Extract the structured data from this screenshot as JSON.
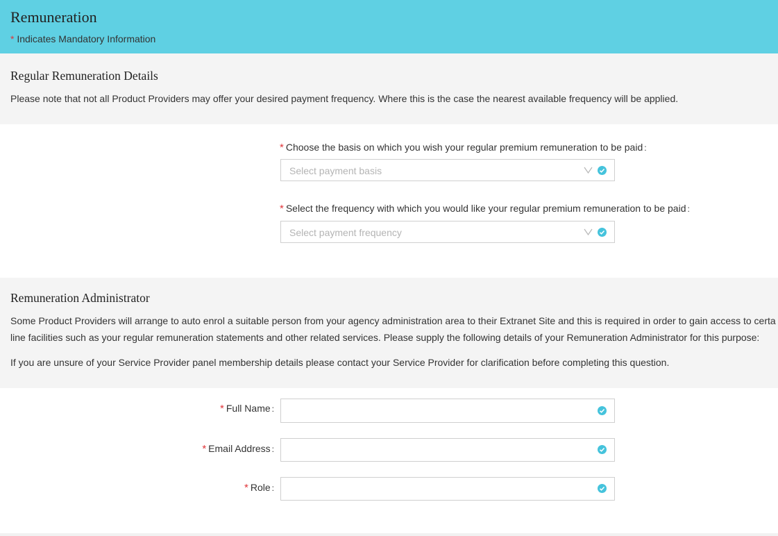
{
  "header": {
    "title": "Remuneration",
    "mandatory_star": "*",
    "mandatory_note": "Indicates Mandatory Information"
  },
  "regular": {
    "title": "Regular Remuneration Details",
    "note": "Please note that not all Product Providers may offer your desired payment frequency. Where this is the case the nearest available frequency will be applied.",
    "basis_label": "Choose the basis on which you wish your regular premium remuneration to be paid",
    "basis_placeholder": "Select payment basis",
    "frequency_label": "Select the frequency with which you would like your regular premium remuneration to be paid",
    "frequency_placeholder": "Select payment frequency"
  },
  "administrator": {
    "title": "Remuneration Administrator",
    "para1_line1": "Some Product Providers will arrange to auto enrol a suitable person from your agency administration area to their Extranet Site and this is required in order to gain access to certa",
    "para1_line2": "line facilities such as your regular remuneration statements and other related services. Please supply the following details of your Remuneration Administrator for this purpose:",
    "para2": "If you are unsure of your Service Provider panel membership details please contact your Service Provider for clarification before completing this question.",
    "full_name_label": "Full Name",
    "email_label": "Email Address",
    "role_label": "Role",
    "full_name_value": "",
    "email_value": "",
    "role_value": ""
  },
  "colors": {
    "header_bg": "#5fd0e3",
    "section_bg": "#f4f4f4",
    "required": "#e0363a",
    "check": "#45c3dc"
  }
}
